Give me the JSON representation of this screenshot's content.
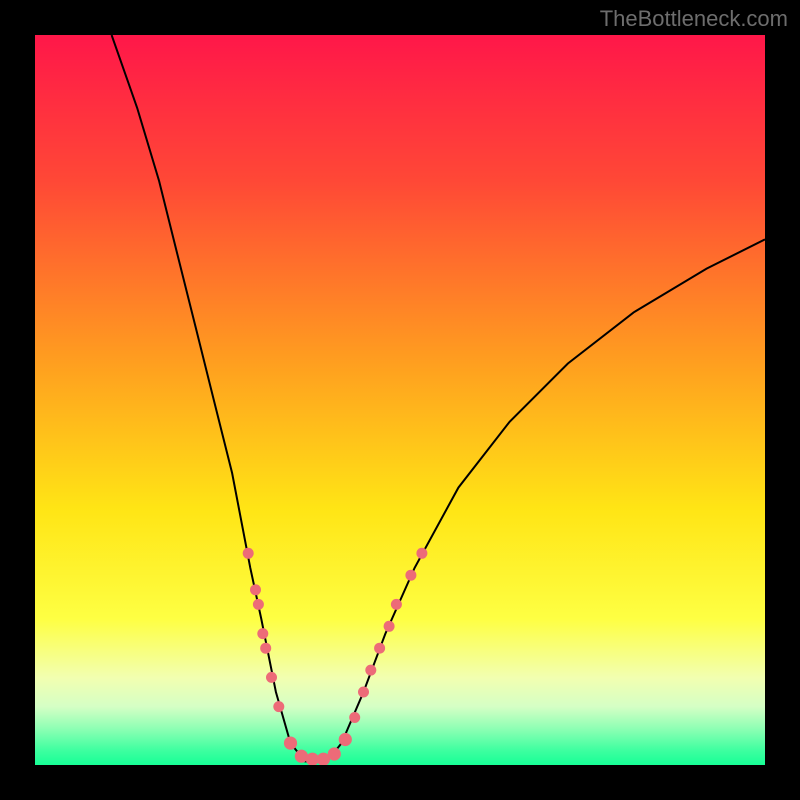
{
  "watermark": "TheBottleneck.com",
  "chart_data": {
    "type": "line",
    "title": "",
    "xlabel": "",
    "ylabel": "",
    "xlim": [
      0,
      100
    ],
    "ylim": [
      0,
      100
    ],
    "gradient_stops": [
      {
        "offset": 0,
        "color": "#ff1749"
      },
      {
        "offset": 20,
        "color": "#ff4836"
      },
      {
        "offset": 45,
        "color": "#ff9f1f"
      },
      {
        "offset": 65,
        "color": "#ffe515"
      },
      {
        "offset": 80,
        "color": "#feff43"
      },
      {
        "offset": 88,
        "color": "#f2ffb0"
      },
      {
        "offset": 92,
        "color": "#d5ffc5"
      },
      {
        "offset": 95,
        "color": "#8effb4"
      },
      {
        "offset": 98,
        "color": "#3effa0"
      },
      {
        "offset": 100,
        "color": "#17ff96"
      }
    ],
    "curve": {
      "description": "V-shaped bottleneck curve",
      "minimum_x": 38,
      "left_branch": [
        {
          "x": 10.5,
          "y": 100
        },
        {
          "x": 14,
          "y": 90
        },
        {
          "x": 17,
          "y": 80
        },
        {
          "x": 19.5,
          "y": 70
        },
        {
          "x": 22,
          "y": 60
        },
        {
          "x": 24.5,
          "y": 50
        },
        {
          "x": 27,
          "y": 40
        },
        {
          "x": 29.5,
          "y": 27
        },
        {
          "x": 31,
          "y": 20
        },
        {
          "x": 33,
          "y": 10
        },
        {
          "x": 35,
          "y": 3
        },
        {
          "x": 37,
          "y": 0.5
        }
      ],
      "right_branch": [
        {
          "x": 40,
          "y": 0.5
        },
        {
          "x": 42,
          "y": 3
        },
        {
          "x": 45,
          "y": 10
        },
        {
          "x": 48,
          "y": 18
        },
        {
          "x": 52,
          "y": 27
        },
        {
          "x": 58,
          "y": 38
        },
        {
          "x": 65,
          "y": 47
        },
        {
          "x": 73,
          "y": 55
        },
        {
          "x": 82,
          "y": 62
        },
        {
          "x": 92,
          "y": 68
        },
        {
          "x": 100,
          "y": 72
        }
      ]
    },
    "markers": [
      {
        "x": 29.2,
        "y": 29,
        "r": 5
      },
      {
        "x": 30.2,
        "y": 24,
        "r": 5
      },
      {
        "x": 30.6,
        "y": 22,
        "r": 5
      },
      {
        "x": 31.2,
        "y": 18,
        "r": 5
      },
      {
        "x": 31.6,
        "y": 16,
        "r": 5
      },
      {
        "x": 32.4,
        "y": 12,
        "r": 5
      },
      {
        "x": 33.4,
        "y": 8,
        "r": 5
      },
      {
        "x": 35.0,
        "y": 3.0,
        "r": 6
      },
      {
        "x": 36.5,
        "y": 1.2,
        "r": 6
      },
      {
        "x": 38.0,
        "y": 0.8,
        "r": 6
      },
      {
        "x": 39.5,
        "y": 0.8,
        "r": 6
      },
      {
        "x": 41.0,
        "y": 1.5,
        "r": 6
      },
      {
        "x": 42.5,
        "y": 3.5,
        "r": 6
      },
      {
        "x": 43.8,
        "y": 6.5,
        "r": 5
      },
      {
        "x": 45.0,
        "y": 10,
        "r": 5
      },
      {
        "x": 46.0,
        "y": 13,
        "r": 5
      },
      {
        "x": 47.2,
        "y": 16,
        "r": 5
      },
      {
        "x": 48.5,
        "y": 19,
        "r": 5
      },
      {
        "x": 49.5,
        "y": 22,
        "r": 5
      },
      {
        "x": 51.5,
        "y": 26,
        "r": 5
      },
      {
        "x": 53.0,
        "y": 29,
        "r": 5
      }
    ],
    "marker_color": "#ed6b78"
  }
}
